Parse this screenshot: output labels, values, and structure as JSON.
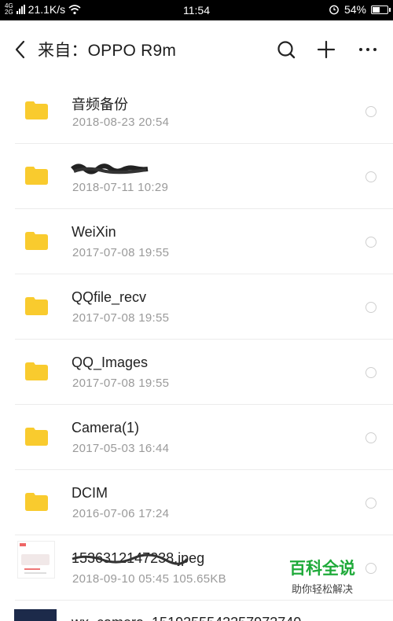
{
  "status_bar": {
    "net_top": "4G",
    "net_bottom": "2G",
    "speed": "21.1K/s",
    "time": "11:54",
    "battery": "54%",
    "battery_level": 0.54
  },
  "header": {
    "title": "来自：OPPO R9m",
    "icons": [
      "back-icon",
      "search-icon",
      "plus-icon",
      "more-icon"
    ]
  },
  "files": [
    {
      "name": "音频备份",
      "meta": "2018-08-23  20:54",
      "type": "folder"
    },
    {
      "name": "",
      "meta": "2018-07-11  10:29",
      "type": "folder",
      "redacted": true
    },
    {
      "name": "WeiXin",
      "meta": "2017-07-08  19:55",
      "type": "folder"
    },
    {
      "name": "QQfile_recv",
      "meta": "2017-07-08  19:55",
      "type": "folder"
    },
    {
      "name": "QQ_Images",
      "meta": "2017-07-08  19:55",
      "type": "folder"
    },
    {
      "name": "Camera(1)",
      "meta": "2017-05-03  16:44",
      "type": "folder"
    },
    {
      "name": "DCIM",
      "meta": "2016-07-06  17:24",
      "type": "folder"
    },
    {
      "name": "1536312147238.jpeg",
      "meta": "2018-09-10  05:45   105.65KB",
      "type": "image"
    }
  ],
  "partial_item": {
    "name": "wx_camera_1519355543357973740"
  },
  "watermark": {
    "title": "百科全说",
    "subtitle": "助你轻松解决"
  },
  "colors": {
    "folder": "#F9CB2E",
    "watermark_green": "#1FAA3A"
  }
}
